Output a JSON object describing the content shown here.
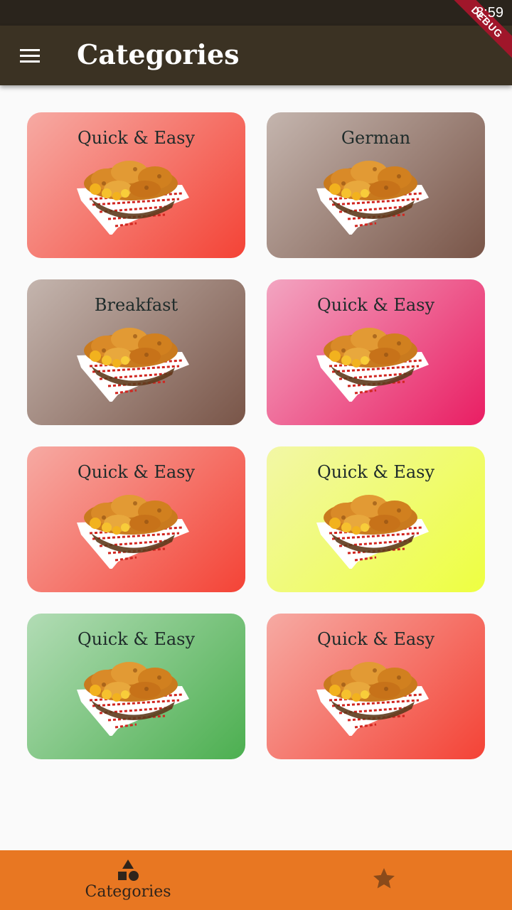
{
  "status_bar": {
    "time": "8:59",
    "debug_label": "DEBUG"
  },
  "app_bar": {
    "title": "Categories",
    "menu_icon": "menu-icon"
  },
  "categories": [
    {
      "title": "Quick & Easy",
      "color_start": "#f6aaa3",
      "color_end": "#f44336",
      "image_icon": "fried-chicken-basket"
    },
    {
      "title": "German",
      "color_start": "#c4b5ae",
      "color_end": "#795548",
      "image_icon": "fried-chicken-basket"
    },
    {
      "title": "Breakfast",
      "color_start": "#c4b5ae",
      "color_end": "#795548",
      "image_icon": "fried-chicken-basket"
    },
    {
      "title": "Quick & Easy",
      "color_start": "#f3a5c1",
      "color_end": "#e91e63",
      "image_icon": "fried-chicken-basket"
    },
    {
      "title": "Quick & Easy",
      "color_start": "#f6aaa3",
      "color_end": "#f44336",
      "image_icon": "fried-chicken-basket"
    },
    {
      "title": "Quick & Easy",
      "color_start": "#f2f7a6",
      "color_end": "#eeff41",
      "image_icon": "fried-chicken-basket"
    },
    {
      "title": "Quick & Easy",
      "color_start": "#b2dcb5",
      "color_end": "#4caf50",
      "image_icon": "fried-chicken-basket"
    },
    {
      "title": "Quick & Easy",
      "color_start": "#f6aaa3",
      "color_end": "#f44336",
      "image_icon": "fried-chicken-basket"
    }
  ],
  "bottom_nav": {
    "background": "#e87722",
    "items": [
      {
        "label": "Categories",
        "icon": "category-shapes-icon",
        "selected": true
      },
      {
        "label": "",
        "icon": "star-icon",
        "selected": false
      }
    ]
  }
}
